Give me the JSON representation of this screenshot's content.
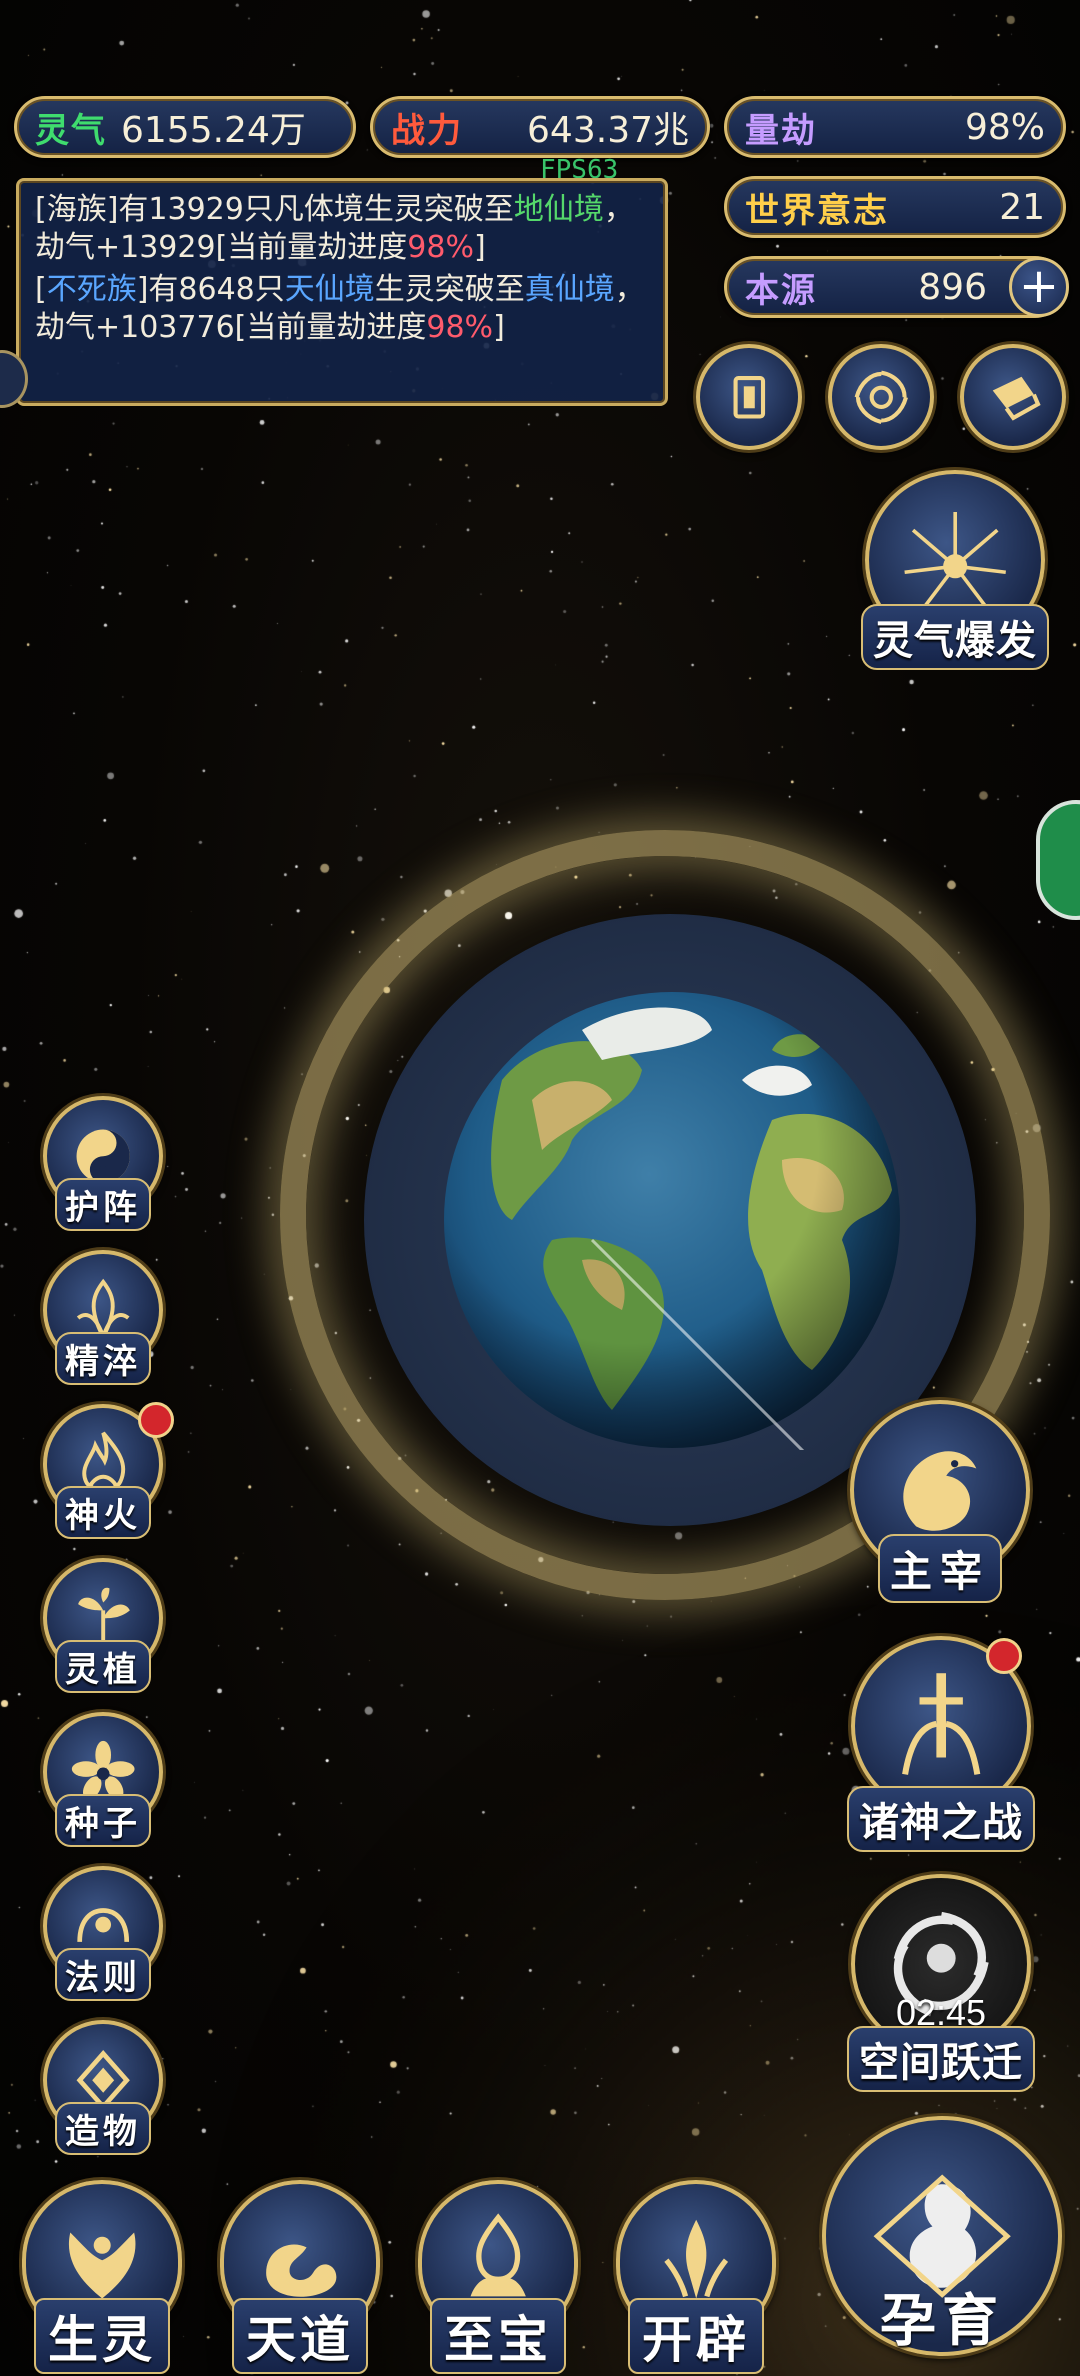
{
  "stats": {
    "lingqi": {
      "label": "灵气",
      "value": "6155.24万",
      "color": "#3fdc6e"
    },
    "zhanli": {
      "label": "战力",
      "value": "643.37兆",
      "color": "#ff5a3c"
    },
    "liangjie": {
      "label": "量劫",
      "value": "98%",
      "color": "#c59cff"
    },
    "shijie": {
      "label": "世界意志",
      "value": "21",
      "color": "#ffcf4a"
    },
    "benyuan": {
      "label": "本源",
      "value": "896",
      "color": "#c59cff"
    }
  },
  "fps": "FPS63",
  "log": [
    {
      "parts": [
        {
          "t": "[海族]有13929只凡体境生灵突破至",
          "c": ""
        },
        {
          "t": "地仙境",
          "c": "green"
        },
        {
          "t": "，劫气+13929[当前量劫进度",
          "c": ""
        },
        {
          "t": "98%",
          "c": "red"
        },
        {
          "t": "]",
          "c": ""
        }
      ]
    },
    {
      "parts": [
        {
          "t": "[",
          "c": ""
        },
        {
          "t": "不死族",
          "c": "blue"
        },
        {
          "t": "]有8648只",
          "c": ""
        },
        {
          "t": "天仙境",
          "c": "blue"
        },
        {
          "t": "生灵突破至",
          "c": ""
        },
        {
          "t": "真仙境",
          "c": "blue"
        },
        {
          "t": "，劫气+103776[当前量劫进度",
          "c": ""
        },
        {
          "t": "98%",
          "c": "red"
        },
        {
          "t": "]",
          "c": ""
        }
      ]
    }
  ],
  "top_icons": [
    "cards-icon",
    "vortex-icon",
    "scroll-icon"
  ],
  "right": {
    "burst": "灵气爆发",
    "lord": "主宰",
    "war": "诸神之战",
    "jump": "空间跃迁",
    "jump_timer": "02:45",
    "nurture": "孕育"
  },
  "left_buttons": [
    {
      "label": "护阵",
      "icon": "yin-yang-icon",
      "badge": false
    },
    {
      "label": "精淬",
      "icon": "flame-lotus-icon",
      "badge": false
    },
    {
      "label": "神火",
      "icon": "fire-icon",
      "badge": true
    },
    {
      "label": "灵植",
      "icon": "plant-icon",
      "badge": false
    },
    {
      "label": "种子",
      "icon": "seed-flower-icon",
      "badge": false
    },
    {
      "label": "法则",
      "icon": "law-rune-icon",
      "badge": false
    },
    {
      "label": "造物",
      "icon": "diamond-rune-icon",
      "badge": false
    }
  ],
  "nav": [
    {
      "label": "生灵",
      "icon": "phoenix-icon"
    },
    {
      "label": "天道",
      "icon": "cloud-swirl-icon"
    },
    {
      "label": "至宝",
      "icon": "treasure-flame-icon"
    },
    {
      "label": "开辟",
      "icon": "axe-flame-icon"
    }
  ]
}
